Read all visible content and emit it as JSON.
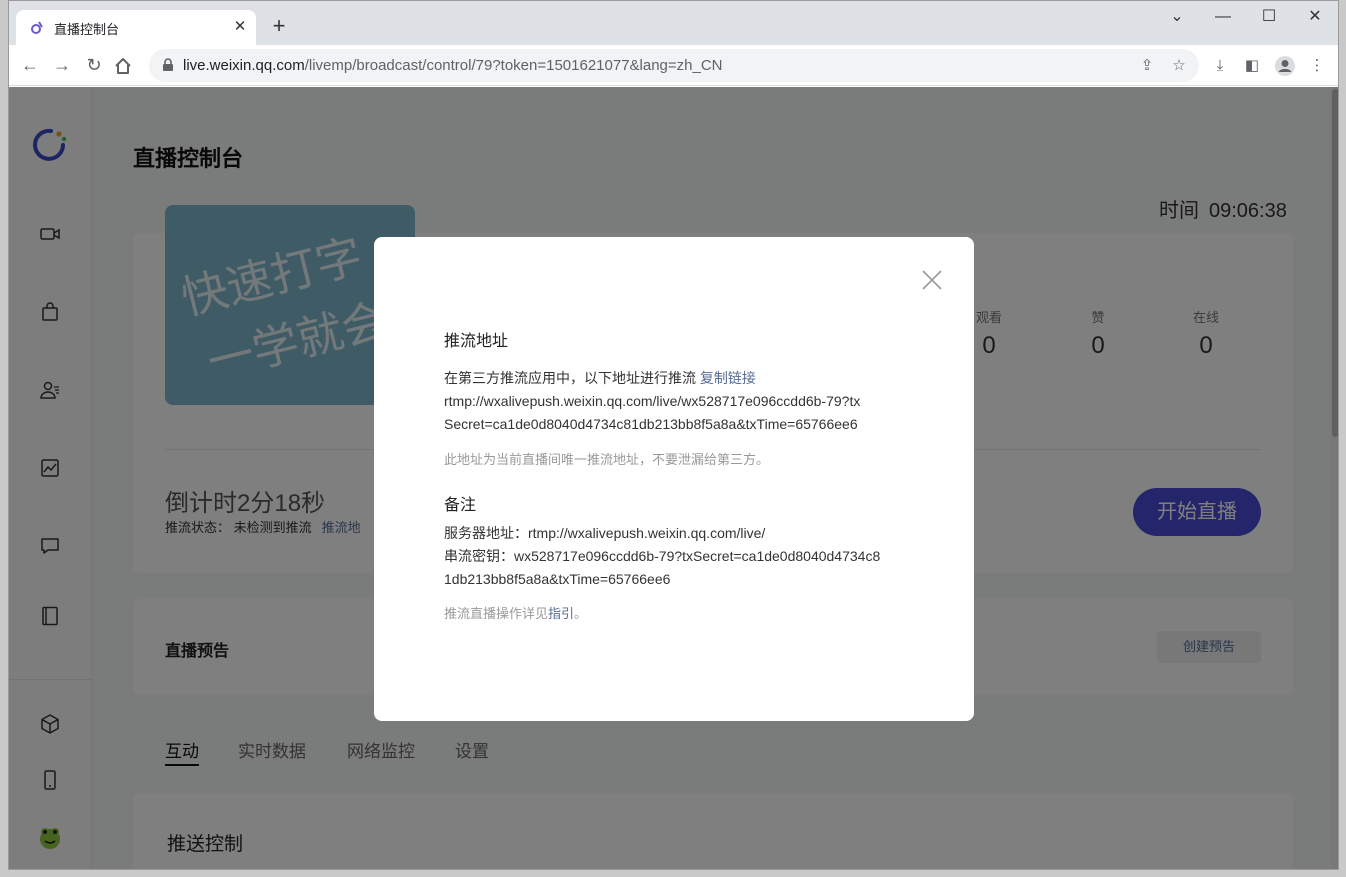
{
  "browser": {
    "tab_title": "直播控制台",
    "url_host": "live.weixin.qq.com",
    "url_path": "/livemp/broadcast/control/79?token=1501621077&lang=zh_CN"
  },
  "header": {
    "page_title": "直播控制台",
    "time_label": "时间",
    "time_value": "09:06:38"
  },
  "cover": {
    "line1": "快速打字",
    "line2": "一学就会"
  },
  "stats": [
    {
      "label": "观看",
      "value": "0"
    },
    {
      "label": "赞",
      "value": "0"
    },
    {
      "label": "在线",
      "value": "0"
    }
  ],
  "live": {
    "countdown": "倒计时2分18秒",
    "push_status": "推流状态：  未检测到推流",
    "push_link": "推流地",
    "start_button": "开始直播"
  },
  "preview": {
    "title": "直播预告",
    "create_button": "创建预告"
  },
  "tabs": [
    "互动",
    "实时数据",
    "网络监控",
    "设置"
  ],
  "push_control_title": "推送控制",
  "modal": {
    "title": "推流地址",
    "intro": "在第三方推流应用中，以下地址进行推流",
    "copy_link": "复制链接",
    "url_line1": "rtmp://wxalivepush.weixin.qq.com/live/wx528717e096ccdd6b-79?tx",
    "url_line2": "Secret=ca1de0d8040d4734c81db213bb8f5a8a&txTime=65766ee6",
    "warning": "此地址为当前直播间唯一推流地址，不要泄漏给第三方。",
    "note_title": "备注",
    "server_line": "服务器地址：rtmp://wxalivepush.weixin.qq.com/live/",
    "key_line1": "串流密钥：wx528717e096ccdd6b-79?txSecret=ca1de0d8040d4734c8",
    "key_line2": "1db213bb8f5a8a&txTime=65766ee6",
    "guide_prefix": "推流直播操作详见",
    "guide_link": "指引",
    "guide_suffix": "。"
  },
  "colors": {
    "accent": "#4a4ad6",
    "link": "#576b95",
    "overlay": "rgba(0,0,0,0.5)"
  }
}
